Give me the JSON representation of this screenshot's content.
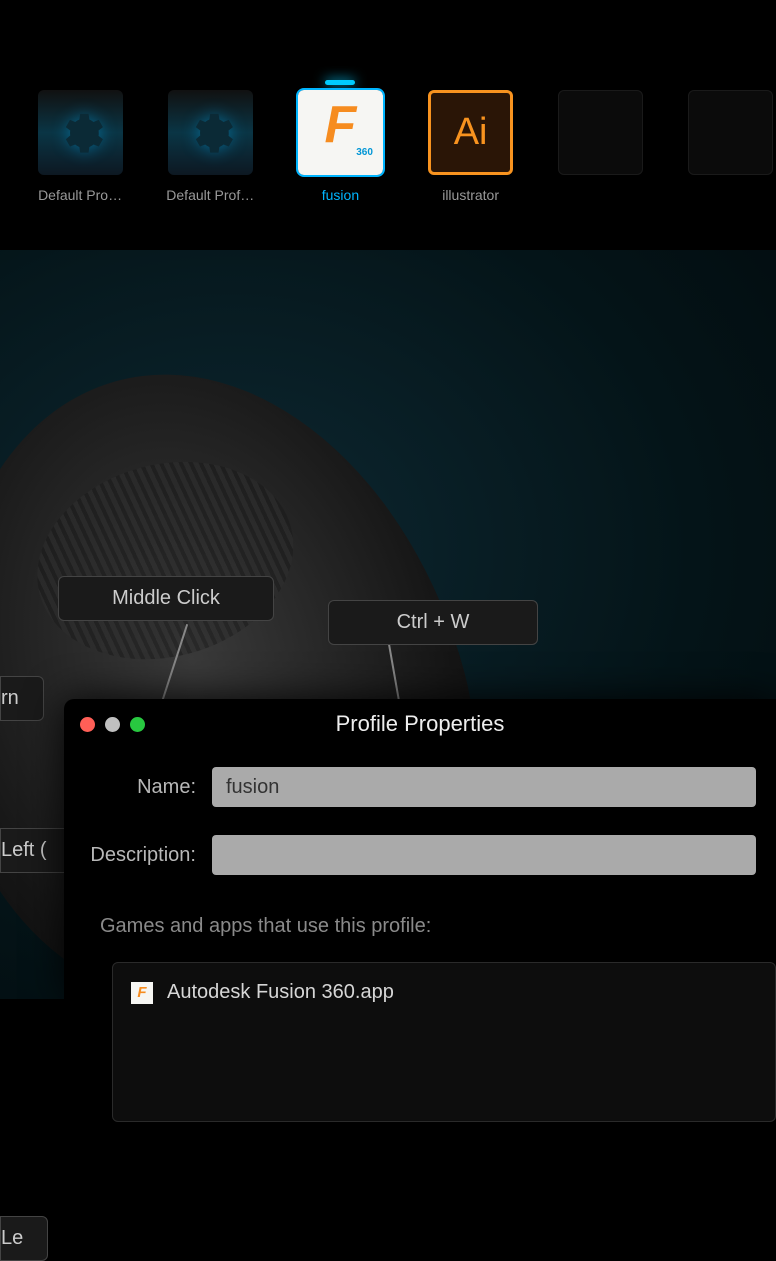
{
  "profiles": {
    "items": [
      {
        "label": "Default Pro…",
        "icon": "gear"
      },
      {
        "label": "Default Prof…",
        "icon": "gear"
      },
      {
        "label": "fusion",
        "icon": "fusion",
        "selected": true
      },
      {
        "label": "illustrator",
        "icon": "illustrator"
      },
      {
        "label": "",
        "icon": "empty"
      },
      {
        "label": "",
        "icon": "empty"
      }
    ],
    "fusion_badge": "360"
  },
  "mouse_bindings": {
    "middle": "Middle Click",
    "ctrl_w": "Ctrl + W",
    "rn": "rn",
    "left_click": "Left (",
    "le": "Le"
  },
  "dialog": {
    "title": "Profile Properties",
    "name_label": "Name:",
    "name_value": "fusion",
    "description_label": "Description:",
    "description_value": "",
    "apps_section": "Games and apps that use this profile:",
    "apps": [
      {
        "name": "Autodesk Fusion 360.app"
      }
    ]
  }
}
